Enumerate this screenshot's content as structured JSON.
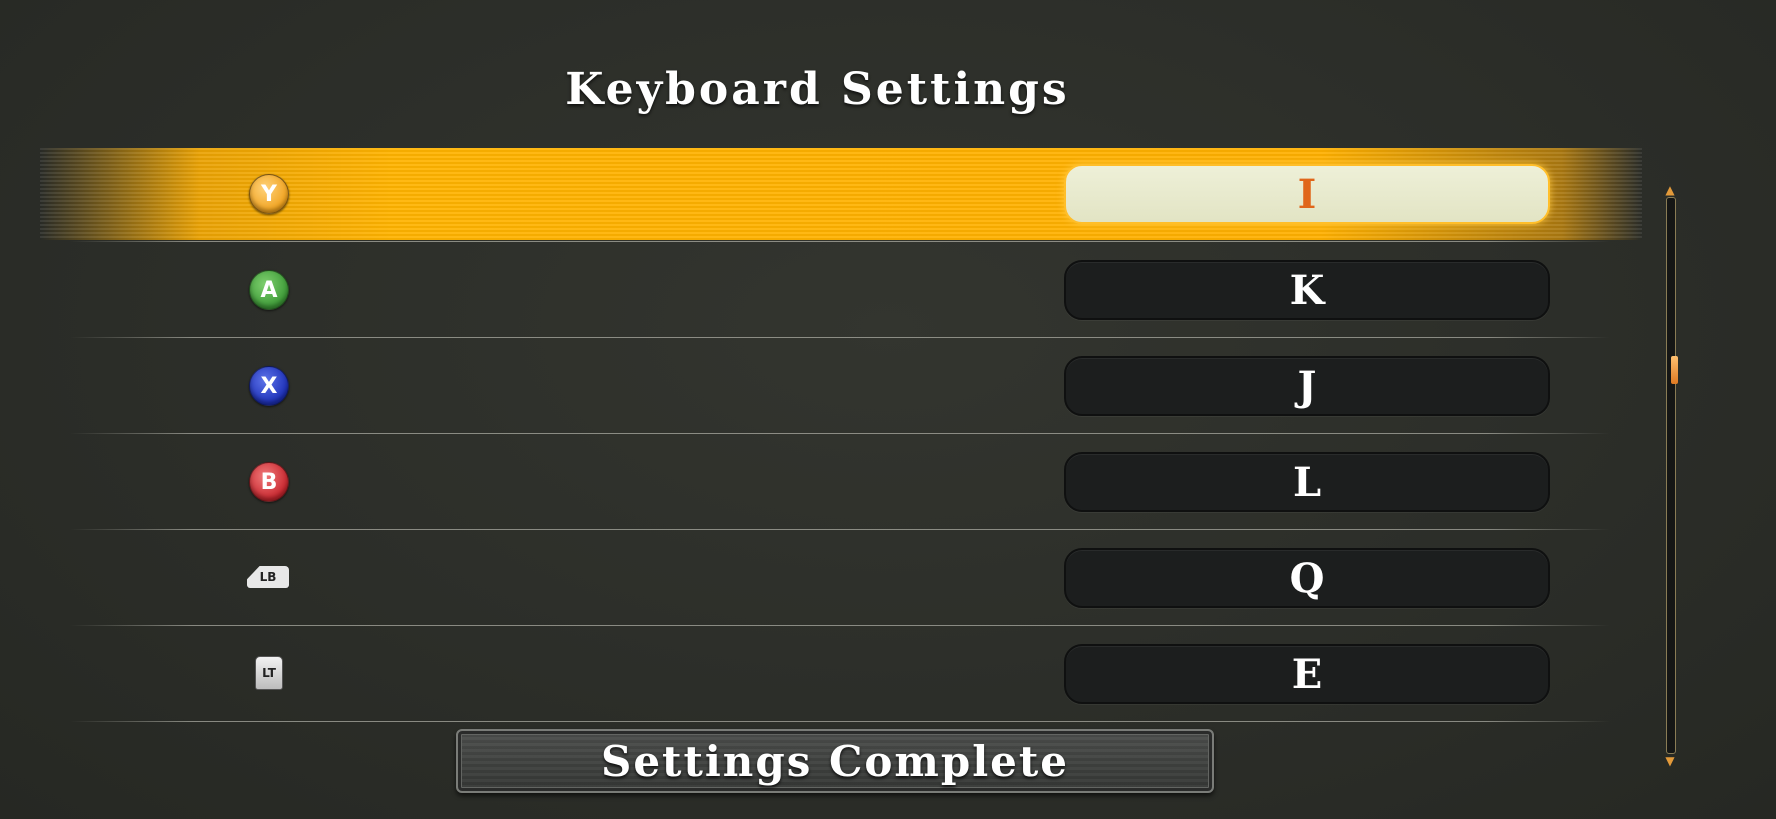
{
  "title": "Keyboard Settings",
  "bindings": [
    {
      "button": "Y",
      "button_icon": "y-button-icon",
      "key": "I",
      "selected": true
    },
    {
      "button": "A",
      "button_icon": "a-button-icon",
      "key": "K",
      "selected": false
    },
    {
      "button": "X",
      "button_icon": "x-button-icon",
      "key": "J",
      "selected": false
    },
    {
      "button": "B",
      "button_icon": "b-button-icon",
      "key": "L",
      "selected": false
    },
    {
      "button": "LB",
      "button_icon": "lb-bumper-icon",
      "key": "Q",
      "selected": false
    },
    {
      "button": "LT",
      "button_icon": "lt-trigger-icon",
      "key": "E",
      "selected": false
    }
  ],
  "complete_label": "Settings Complete",
  "scrollbar": {
    "position_fraction": 0.3
  },
  "colors": {
    "highlight": "#ffb300",
    "selected_key_text": "#e0661a",
    "key_text": "#ffffff",
    "key_box": "#1c1e1e",
    "scroll_thumb": "#e07a22"
  }
}
